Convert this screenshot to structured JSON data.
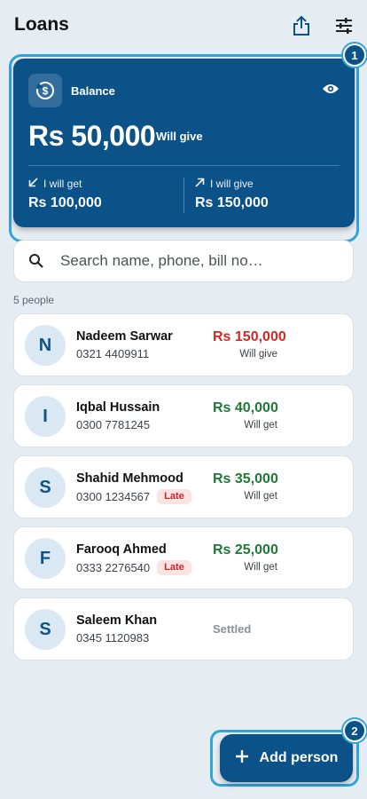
{
  "header": {
    "title": "Loans",
    "icons": [
      "share-icon",
      "filter-sliders-icon"
    ]
  },
  "balance_card": {
    "label": "Balance",
    "amount": "Rs 50,000",
    "direction": "Will give",
    "get_label": "I will get",
    "get_amount": "Rs 100,000",
    "give_label": "I will give",
    "give_amount": "Rs 150,000",
    "badge": "1",
    "icons": [
      "balance-exchange-icon",
      "eye-icon",
      "arrow-down-left-icon",
      "arrow-up-right-icon"
    ]
  },
  "search": {
    "placeholder": "Search name, phone, bill no…",
    "value": ""
  },
  "people_count": "5 people",
  "people": [
    {
      "initial": "N",
      "name": "Nadeem Sarwar",
      "phone": "0321 4409911",
      "late": "",
      "amount": "Rs 150,000",
      "direction": "Will give",
      "status": "give"
    },
    {
      "initial": "I",
      "name": "Iqbal Hussain",
      "phone": "0300 7781245",
      "late": "",
      "amount": "Rs 40,000",
      "direction": "Will get",
      "status": "get"
    },
    {
      "initial": "S",
      "name": "Shahid Mehmood",
      "phone": "0300 1234567",
      "late": "Late",
      "amount": "Rs 35,000",
      "direction": "Will get",
      "status": "get"
    },
    {
      "initial": "F",
      "name": "Farooq Ahmed",
      "phone": "0333 2276540",
      "late": "Late",
      "amount": "Rs 25,000",
      "direction": "Will get",
      "status": "get"
    },
    {
      "initial": "S",
      "name": "Saleem Khan",
      "phone": "0345 1120983",
      "late": "",
      "amount": "Settled",
      "direction": "",
      "status": "settled"
    }
  ],
  "fab": {
    "label": "Add person",
    "badge": "2"
  },
  "colors": {
    "primary": "#0b5288",
    "give": "#cf2a27",
    "get": "#1e7a36",
    "highlight": "#33a3dc",
    "background": "#e6edf2"
  }
}
